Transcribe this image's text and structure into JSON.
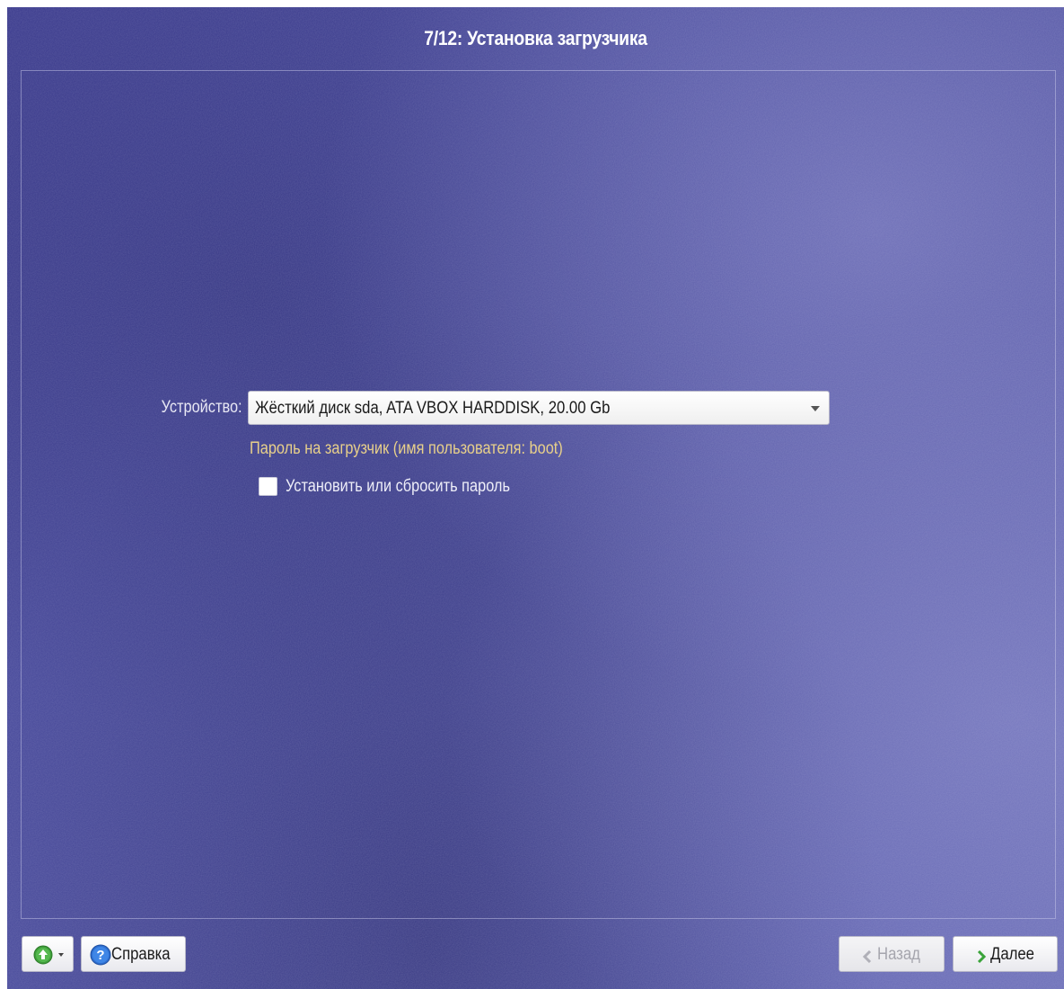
{
  "window": {
    "title": "7/12: Установка загрузчика"
  },
  "form": {
    "device_label": "Устройство:",
    "device_value": "Жёсткий диск sda, ATA VBOX HARDDISK, 20.00 Gb",
    "password_caption": "Пароль на загрузчик (имя пользователя: boot)",
    "password_checkbox_label": "Установить или сбросить пароль",
    "password_checkbox_checked": false
  },
  "footer": {
    "help_label": "Справка",
    "back_label": "Назад",
    "back_enabled": false,
    "next_label": "Далее"
  },
  "icons": {
    "menu": "green-circle-arrow-icon",
    "help": "help-question-icon",
    "back": "chevron-left-icon",
    "next": "chevron-right-icon"
  },
  "colors": {
    "background": "#46489a",
    "caption": "#e8d08a",
    "next_chevron": "#3aa33a"
  }
}
